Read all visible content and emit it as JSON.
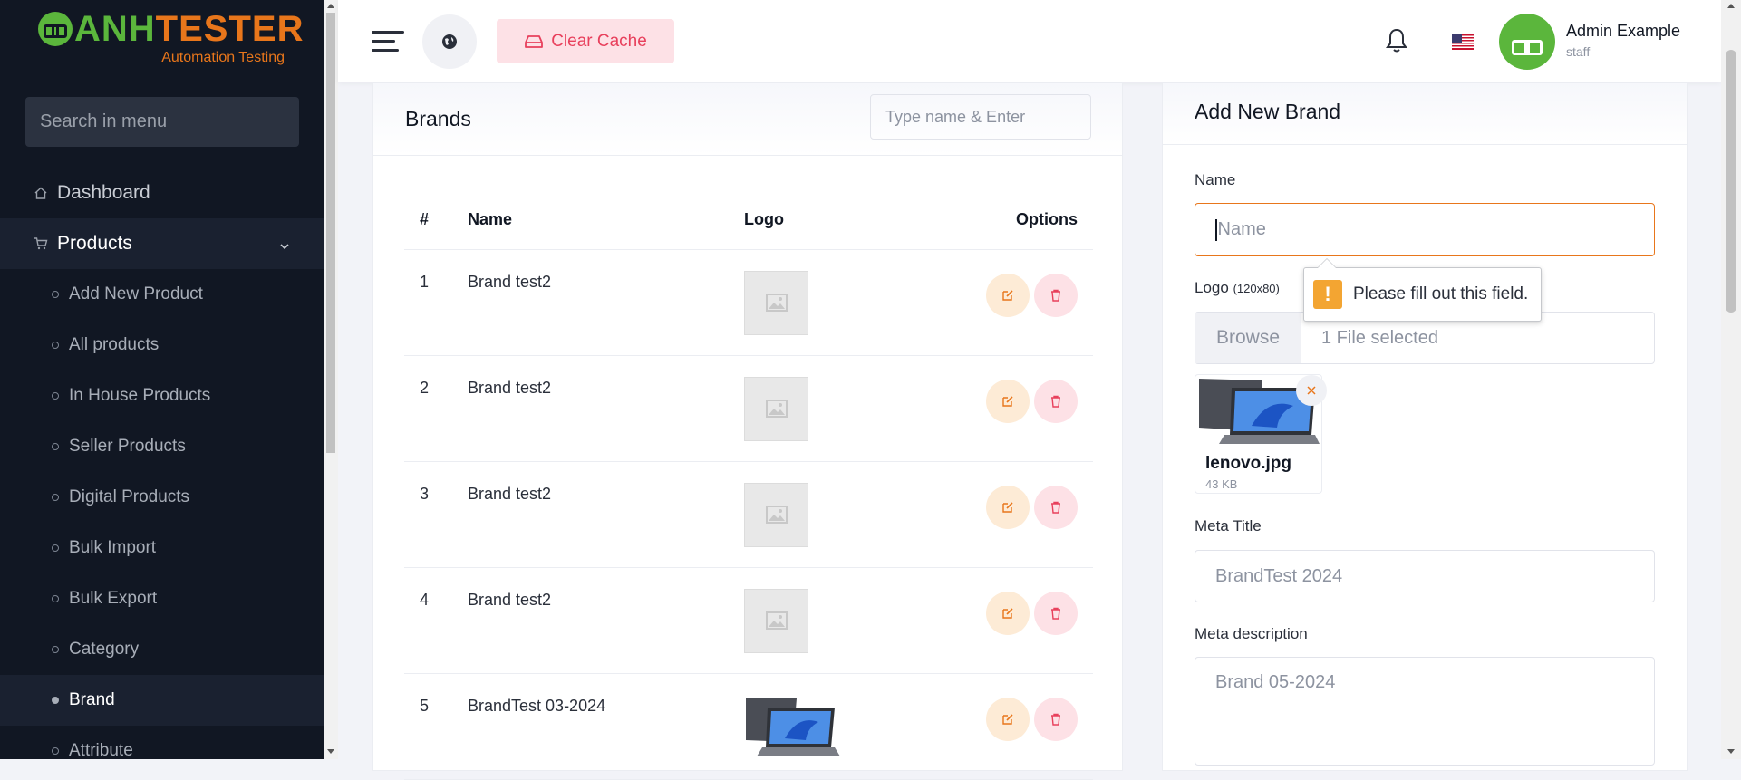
{
  "brand": {
    "part1": "ANH",
    "part2": "TESTER",
    "tagline": "Automation Testing",
    "colors": {
      "green": "#5bb63c",
      "orange": "#e8761b"
    }
  },
  "sidebar": {
    "search_placeholder": "Search in menu",
    "items": [
      {
        "label": "Dashboard",
        "icon": "home-icon"
      },
      {
        "label": "Products",
        "icon": "cart-icon",
        "expanded": true
      }
    ],
    "sub_items": [
      {
        "label": "Add New Product",
        "active": false
      },
      {
        "label": "All products",
        "active": false
      },
      {
        "label": "In House Products",
        "active": false
      },
      {
        "label": "Seller Products",
        "active": false
      },
      {
        "label": "Digital Products",
        "active": false
      },
      {
        "label": "Bulk Import",
        "active": false
      },
      {
        "label": "Bulk Export",
        "active": false
      },
      {
        "label": "Category",
        "active": false
      },
      {
        "label": "Brand",
        "active": true
      },
      {
        "label": "Attribute",
        "active": false
      }
    ]
  },
  "header": {
    "clear_cache_label": "Clear Cache",
    "user_name": "Admin Example",
    "user_role": "staff",
    "icons": [
      "menu-icon",
      "globe-icon",
      "hard-drive-icon",
      "bell-icon",
      "us-flag-icon"
    ]
  },
  "brands": {
    "title": "Brands",
    "search_placeholder": "Type name & Enter",
    "columns": {
      "num": "#",
      "name": "Name",
      "logo": "Logo",
      "options": "Options"
    },
    "rows": [
      {
        "num": "1",
        "name": "Brand test2",
        "logo": "placeholder"
      },
      {
        "num": "2",
        "name": "Brand test2",
        "logo": "placeholder"
      },
      {
        "num": "3",
        "name": "Brand test2",
        "logo": "placeholder"
      },
      {
        "num": "4",
        "name": "Brand test2",
        "logo": "placeholder"
      },
      {
        "num": "5",
        "name": "BrandTest 03-2024",
        "logo": "laptop"
      }
    ]
  },
  "add_brand": {
    "title": "Add New Brand",
    "name_label": "Name",
    "name_placeholder": "Name",
    "logo_label": "Logo",
    "logo_hint": "(120x80)",
    "browse_label": "Browse",
    "file_status": "1 File selected",
    "file_name": "lenovo.jpg",
    "file_size": "43 KB",
    "meta_title_label": "Meta Title",
    "meta_title_placeholder": "BrandTest 2024",
    "meta_desc_label": "Meta description",
    "meta_desc_placeholder": "Brand 05-2024",
    "validation_message": "Please fill out this field."
  }
}
